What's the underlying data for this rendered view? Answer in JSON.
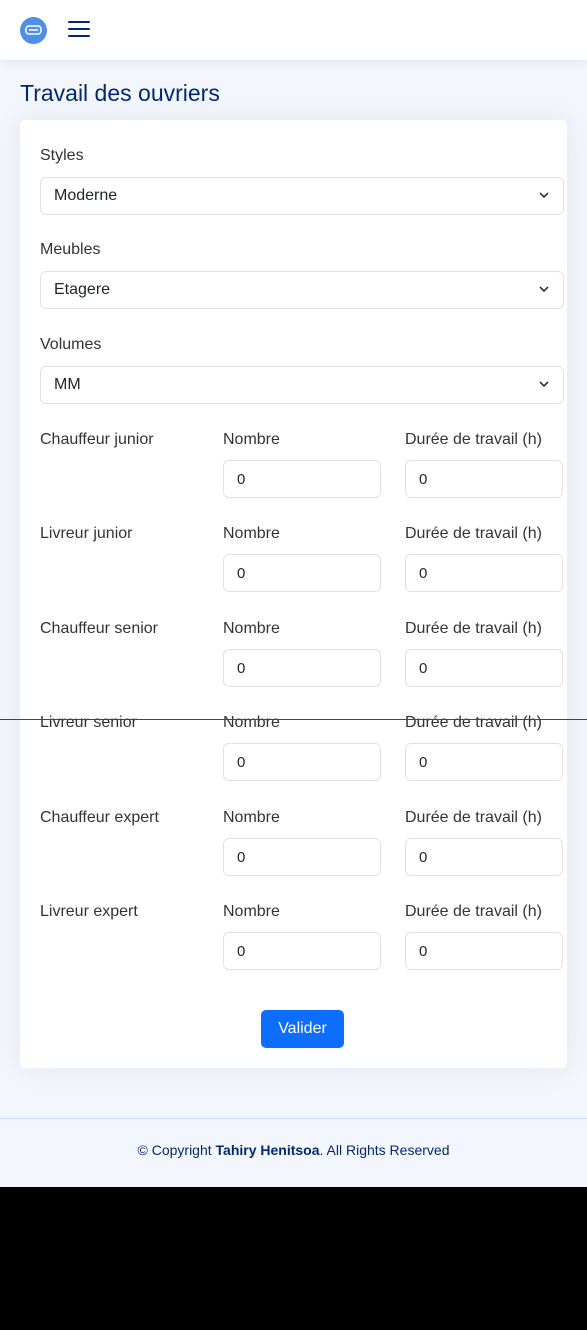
{
  "header": {
    "logo_icon": "sofa-icon",
    "menu_icon": "hamburger-icon"
  },
  "page_title": "Travail des ouvriers",
  "form": {
    "styles": {
      "label": "Styles",
      "value": "Moderne"
    },
    "meubles": {
      "label": "Meubles",
      "value": "Etagere"
    },
    "volumes": {
      "label": "Volumes",
      "value": "MM"
    },
    "col_nombre": "Nombre",
    "col_duree": "Durée de travail (h)",
    "workers": [
      {
        "name": "Chauffeur junior",
        "nombre": "0",
        "duree": "0"
      },
      {
        "name": "Livreur junior",
        "nombre": "0",
        "duree": "0"
      },
      {
        "name": "Chauffeur senior",
        "nombre": "0",
        "duree": "0"
      },
      {
        "name": "Livreur senior",
        "nombre": "0",
        "duree": "0"
      },
      {
        "name": "Chauffeur expert",
        "nombre": "0",
        "duree": "0"
      },
      {
        "name": "Livreur expert",
        "nombre": "0",
        "duree": "0"
      }
    ],
    "submit_label": "Valider"
  },
  "footer": {
    "prefix": "© Copyright ",
    "owner": "Tahiry Henitsoa",
    "suffix": ". All Rights Reserved"
  },
  "colors": {
    "primary": "#0d6efd",
    "title": "#012970",
    "background": "#f4f6fd"
  }
}
